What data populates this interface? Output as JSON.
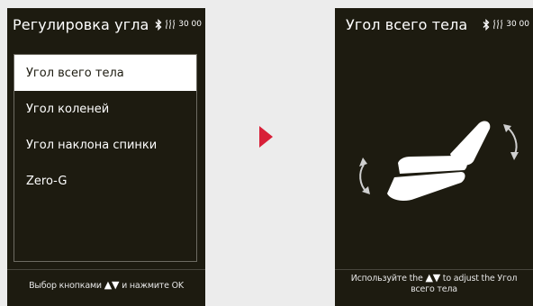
{
  "left_screen": {
    "title": "Регулировка угла",
    "time": "30 00",
    "menu_items": [
      {
        "label": "Угол всего тела",
        "selected": true
      },
      {
        "label": "Угол коленей",
        "selected": false
      },
      {
        "label": "Угол наклона спинки",
        "selected": false
      },
      {
        "label": "Zero-G",
        "selected": false
      }
    ],
    "hint_prefix": "Выбор кнопками",
    "hint_suffix": "и нажмите OK"
  },
  "right_screen": {
    "title": "Угол всего тела",
    "time": "30 00",
    "hint_prefix": "Используйте the",
    "hint_suffix": "to adjust the Угол всего тела"
  },
  "icons": {
    "bluetooth": "bluetooth-icon",
    "heat": "heat-icon",
    "next": "next-arrow-icon",
    "chair": "massage-chair-icon",
    "rotate_cw": "rotate-clockwise-icon",
    "rotate_ccw": "rotate-counterclockwise-icon",
    "up": "up-triangle-icon",
    "down": "down-triangle-icon"
  },
  "colors": {
    "screen_bg": "#1d1b10",
    "page_bg": "#ececec",
    "accent_arrow": "#d81f38",
    "selected_bg": "#ffffff"
  }
}
